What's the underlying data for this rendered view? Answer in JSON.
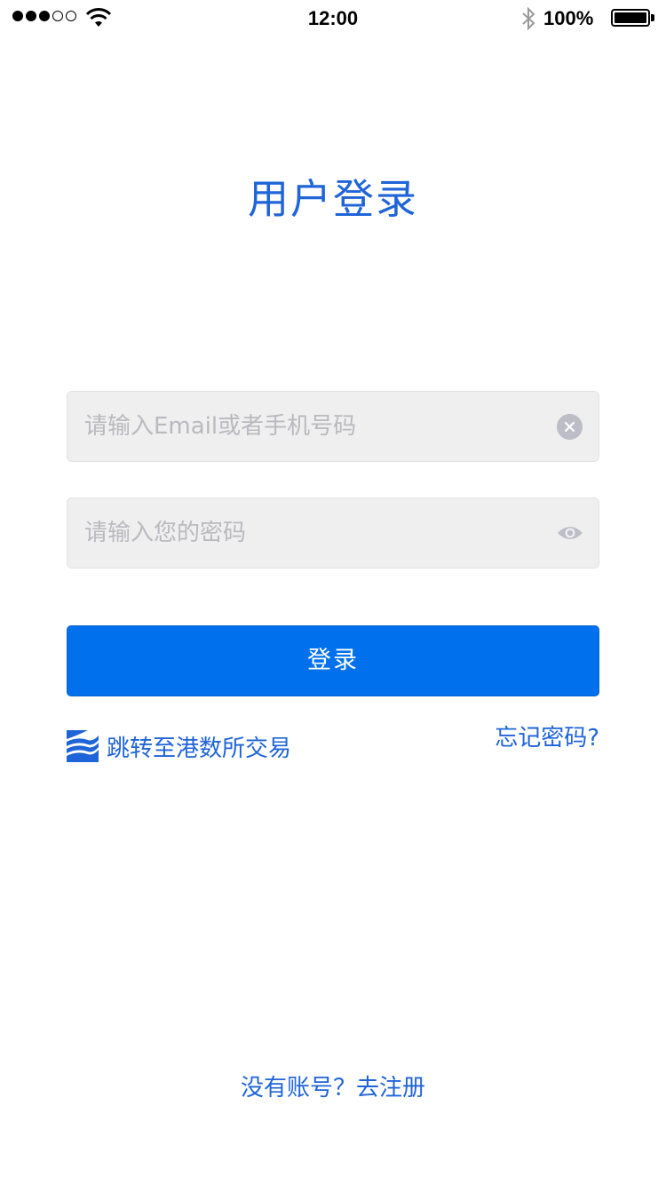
{
  "status_bar": {
    "time": "12:00",
    "battery_percent": "100%",
    "signal_bars_filled": 3,
    "signal_bars_total": 5,
    "icons": [
      "signal-dots-icon",
      "wifi-icon",
      "bluetooth-icon",
      "battery-icon"
    ]
  },
  "page": {
    "title": "用户登录"
  },
  "form": {
    "account_placeholder": "请输入Email或者手机号码",
    "account_value": "",
    "password_placeholder": "请输入您的密码",
    "password_value": "",
    "login_label": "登录"
  },
  "links": {
    "exchange_label": "跳转至港数所交易",
    "forgot_label": "忘记密码?",
    "register_label": "没有账号？去注册"
  },
  "colors": {
    "accent": "#1f64d8",
    "button": "#0070ec",
    "field_background": "#efefef",
    "placeholder": "#b9b9bf"
  }
}
